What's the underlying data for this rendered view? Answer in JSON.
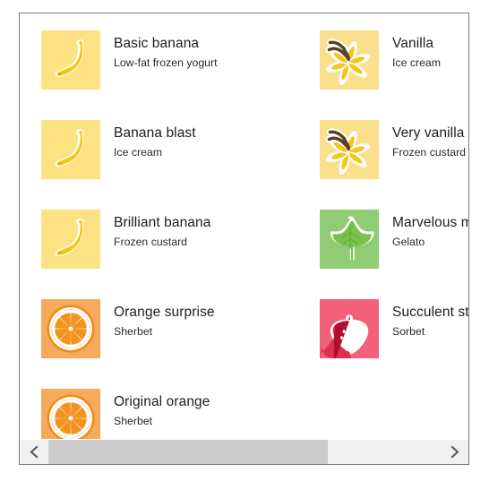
{
  "window": {
    "border_color": "#7a7a7a",
    "background": "#ffffff"
  },
  "flavor_list": {
    "columns": 2,
    "items": [
      {
        "id": "basic-banana",
        "title": "Basic banana",
        "subtitle": "Low-fat frozen yogurt",
        "icon": "banana-icon",
        "tile_color": "#FCE283",
        "accent_color": "#F2C80F",
        "col": 0,
        "row": 0
      },
      {
        "id": "vanilla",
        "title": "Vanilla",
        "subtitle": "Ice cream",
        "icon": "vanilla-flower-icon",
        "tile_color": "#FADF8C",
        "accent_color": "#F5C518",
        "col": 1,
        "row": 0
      },
      {
        "id": "banana-blast",
        "title": "Banana blast",
        "subtitle": "Ice cream",
        "icon": "banana-icon",
        "tile_color": "#FCE283",
        "accent_color": "#F2C80F",
        "col": 0,
        "row": 1
      },
      {
        "id": "very-vanilla",
        "title": "Very vanilla",
        "subtitle": "Frozen custard",
        "icon": "vanilla-flower-icon",
        "tile_color": "#FADF8C",
        "accent_color": "#F5C518",
        "col": 1,
        "row": 1
      },
      {
        "id": "brilliant-banana",
        "title": "Brilliant banana",
        "subtitle": "Frozen custard",
        "icon": "banana-icon",
        "tile_color": "#FCE283",
        "accent_color": "#F2C80F",
        "col": 0,
        "row": 2
      },
      {
        "id": "marvelous-mint",
        "title": "Marvelous mint",
        "subtitle": "Gelato",
        "icon": "mint-leaf-icon",
        "tile_color": "#90CC73",
        "accent_color": "#6FB451",
        "col": 1,
        "row": 2
      },
      {
        "id": "orange-surprise",
        "title": "Orange surprise",
        "subtitle": "Sherbet",
        "icon": "orange-slice-icon",
        "tile_color": "#F6AA5C",
        "accent_color": "#F4921E",
        "col": 0,
        "row": 3
      },
      {
        "id": "succulent-strawberry",
        "title": "Succulent strawberry",
        "subtitle": "Sorbet",
        "icon": "strawberry-icon",
        "tile_color": "#F2607A",
        "accent_color": "#C8102E",
        "col": 1,
        "row": 3
      },
      {
        "id": "original-orange",
        "title": "Original orange",
        "subtitle": "Sherbet",
        "icon": "orange-slice-icon",
        "tile_color": "#F6AA5C",
        "accent_color": "#F4921E",
        "col": 0,
        "row": 4
      }
    ]
  },
  "scrollbar": {
    "orientation": "horizontal",
    "left_arrow_glyph": "‹",
    "right_arrow_glyph": "›",
    "thumb_percent": 71.5,
    "track_color": "#f0f0f0",
    "thumb_color": "#cdcdcd"
  }
}
